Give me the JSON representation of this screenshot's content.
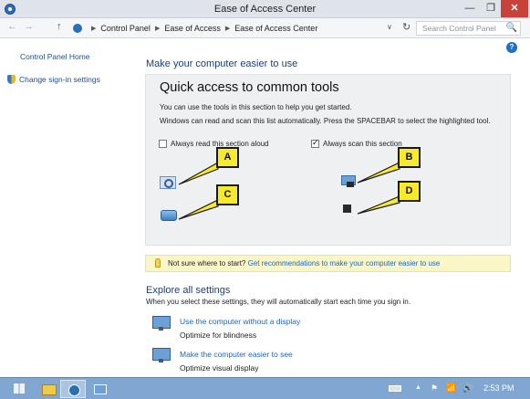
{
  "window": {
    "title": "Ease of Access Center",
    "minimize_glyph": "—",
    "maximize_glyph": "❐",
    "close_glyph": "✕"
  },
  "address_bar": {
    "back_glyph": "←",
    "forward_glyph": "→",
    "up_glyph": "↑",
    "breadcrumbs": [
      "Control Panel",
      "Ease of Access",
      "Ease of Access Center"
    ],
    "dropdown_glyph": "∨",
    "refresh_glyph": "↻",
    "search_placeholder": "Search Control Panel",
    "search_icon": "🔍"
  },
  "help_glyph": "?",
  "sidebar": {
    "home_link": "Control Panel Home",
    "signin_link": "Change sign-in settings"
  },
  "main": {
    "title": "Make your computer easier to use",
    "quick_access": {
      "title": "Quick access to common tools",
      "line1": "You can use the tools in this section to help you get started.",
      "line2": "Windows can read and scan this list automatically.  Press the SPACEBAR to select the highlighted tool.",
      "read_aloud": {
        "label": "Always read this section aloud",
        "checked": false
      },
      "scan": {
        "label": "Always scan this section",
        "checked": true
      }
    },
    "tools": {
      "magnifier_icon": "magnifier-icon",
      "narrator_icon": "narrator-icon",
      "keyboard_icon": "on-screen-keyboard-icon",
      "contrast_icon": "high-contrast-icon"
    },
    "callouts": {
      "a": "A",
      "b": "B",
      "c": "C",
      "d": "D"
    },
    "callout_color": "#f7ea2c",
    "tip": {
      "text": "Not sure where to start?",
      "link": "Get recommendations to make your computer easier to use"
    },
    "explore": {
      "title": "Explore all settings",
      "subtitle": "When you select these settings, they will automatically start each time you sign in.",
      "items": [
        {
          "link": "Use the computer without a display",
          "description": "Optimize for blindness"
        },
        {
          "link": "Make the computer easier to see",
          "description": "Optimize visual display"
        }
      ]
    }
  },
  "taskbar": {
    "clock": "2:53 PM",
    "tray_up_glyph": "▲",
    "flag_glyph": "⚑",
    "network_glyph": "📶",
    "volume_glyph": "🔊"
  }
}
